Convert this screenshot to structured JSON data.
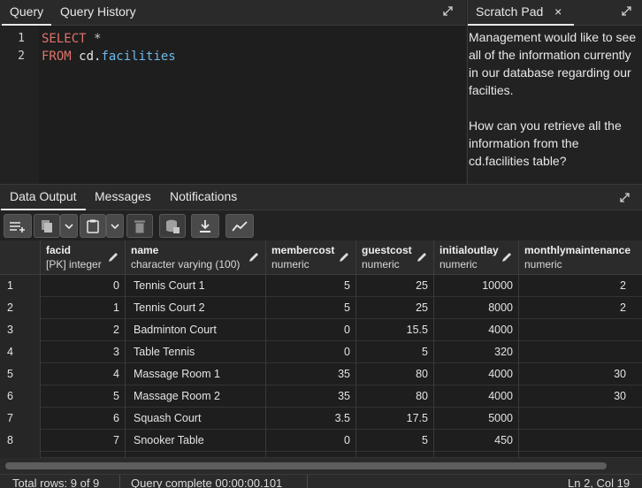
{
  "query_panel": {
    "tabs": [
      "Query",
      "Query History"
    ],
    "lines": [
      "1",
      "2"
    ],
    "code": {
      "line1_kw": "SELECT",
      "line1_rest": " *",
      "line2_kw": "FROM",
      "line2_schema": " cd",
      "line2_dot": ".",
      "line2_table": "facilities"
    }
  },
  "scratch_pad": {
    "title": "Scratch Pad",
    "close": "×",
    "para1": "Management would like to see all of the information currently in our database regarding our facilties.",
    "para2": "How can you retrieve all the information from the cd.facilities table?"
  },
  "output_tabs": [
    "Data Output",
    "Messages",
    "Notifications"
  ],
  "grid": {
    "columns": [
      {
        "name": "facid",
        "type": "[PK] integer"
      },
      {
        "name": "name",
        "type": "character varying (100)"
      },
      {
        "name": "membercost",
        "type": "numeric"
      },
      {
        "name": "guestcost",
        "type": "numeric"
      },
      {
        "name": "initialoutlay",
        "type": "numeric"
      },
      {
        "name": "monthlymaintenance",
        "type": "numeric"
      }
    ],
    "rows": [
      {
        "n": "1",
        "facid": "0",
        "name": "Tennis Court 1",
        "membercost": "5",
        "guestcost": "25",
        "initialoutlay": "10000",
        "monthly": "2"
      },
      {
        "n": "2",
        "facid": "1",
        "name": "Tennis Court 2",
        "membercost": "5",
        "guestcost": "25",
        "initialoutlay": "8000",
        "monthly": "2"
      },
      {
        "n": "3",
        "facid": "2",
        "name": "Badminton Court",
        "membercost": "0",
        "guestcost": "15.5",
        "initialoutlay": "4000",
        "monthly": ""
      },
      {
        "n": "4",
        "facid": "3",
        "name": "Table Tennis",
        "membercost": "0",
        "guestcost": "5",
        "initialoutlay": "320",
        "monthly": ""
      },
      {
        "n": "5",
        "facid": "4",
        "name": "Massage Room 1",
        "membercost": "35",
        "guestcost": "80",
        "initialoutlay": "4000",
        "monthly": "30"
      },
      {
        "n": "6",
        "facid": "5",
        "name": "Massage Room 2",
        "membercost": "35",
        "guestcost": "80",
        "initialoutlay": "4000",
        "monthly": "30"
      },
      {
        "n": "7",
        "facid": "6",
        "name": "Squash Court",
        "membercost": "3.5",
        "guestcost": "17.5",
        "initialoutlay": "5000",
        "monthly": ""
      },
      {
        "n": "8",
        "facid": "7",
        "name": "Snooker Table",
        "membercost": "0",
        "guestcost": "5",
        "initialoutlay": "450",
        "monthly": ""
      }
    ]
  },
  "status": {
    "total_rows": "Total rows: 9 of 9",
    "query_complete": "Query complete 00:00:00.101",
    "cursor": "Ln 2, Col 19"
  },
  "colors": {
    "keyword": "#e0736a",
    "identifier": "#6db9ea",
    "background": "#1e1e1e"
  }
}
